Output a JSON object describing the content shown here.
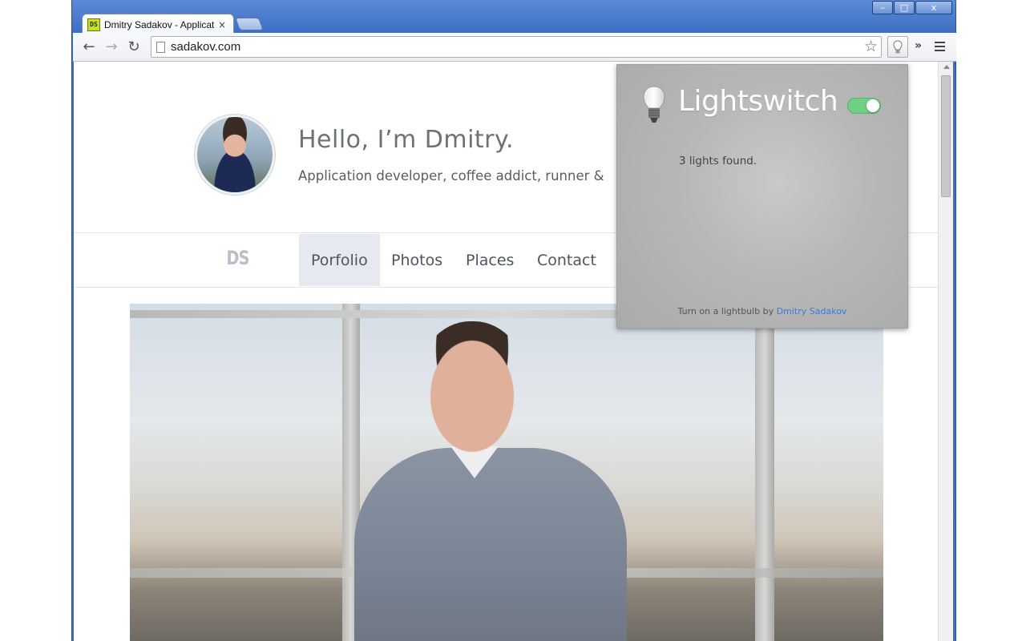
{
  "window": {
    "controls": {
      "minimize": "–",
      "maximize": "□",
      "close": "x"
    }
  },
  "tab": {
    "favicon_text": "DS",
    "title": "Dmitry Sadakov - Applicat",
    "close_glyph": "×"
  },
  "toolbar": {
    "back_glyph": "←",
    "forward_glyph": "→",
    "reload_glyph": "↻",
    "url": "sadakov.com",
    "star_glyph": "☆",
    "overflow_glyph": "»"
  },
  "page": {
    "greeting": "Hello, I’m Dmitry.",
    "tagline": "Application developer, coffee addict, runner &",
    "logo": "DS",
    "nav": [
      {
        "label": "Porfolio",
        "active": true
      },
      {
        "label": "Photos",
        "active": false
      },
      {
        "label": "Places",
        "active": false
      },
      {
        "label": "Contact",
        "active": false
      }
    ]
  },
  "popup": {
    "title": "Lightswitch",
    "toggle_on": true,
    "status": "3 lights found.",
    "footer_text": "Turn on a lightbulb by ",
    "footer_link": "Dmitry Sadakov",
    "accent": "#6fcf83",
    "link_color": "#3a7ad8"
  }
}
